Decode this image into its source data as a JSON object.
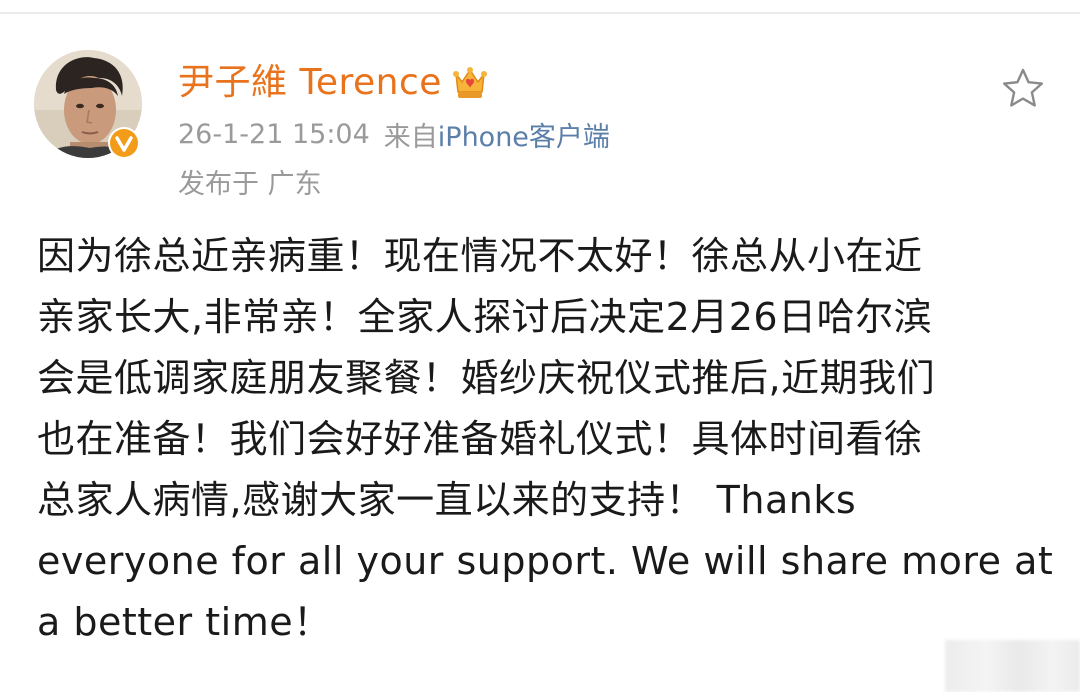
{
  "post": {
    "author": {
      "name": "尹子維 Terence",
      "avatar_icon": "avatar-photo",
      "badges": [
        "crown-vip-icon",
        "verified-icon"
      ],
      "name_color": "#e8731c"
    },
    "timestamp": "26-1-21 15:04",
    "source_prefix": "来自",
    "source": "iPhone客户端",
    "location": "发布于 广东",
    "favorite_icon": "star-icon",
    "body_lines": [
      "因为徐总近亲病重！现在情况不太好！徐总从小在近",
      "亲家长大,非常亲！全家人探讨后决定2月26日哈尔滨",
      "会是低调家庭朋友聚餐！婚纱庆祝仪式推后,近期我们",
      "也在准备！我们会好好准备婚礼仪式！具体时间看徐",
      "总家人病情,感谢大家一直以来的支持！ Thanks",
      "everyone for all your support.  We will share more at",
      "a better time！"
    ]
  },
  "colors": {
    "accent": "#e8731c",
    "link": "#5b7fa8",
    "meta": "#9a9a9a",
    "text": "#1a1a1a"
  }
}
